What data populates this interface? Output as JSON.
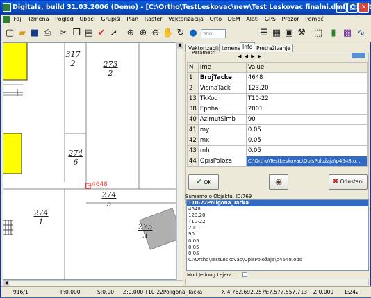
{
  "window": {
    "title": "Digitals, build 31.03.2006 (Demo) - [C:\\Ortho\\TestLeskovac\\new\\Test Leskovac finalni.dmf, C:\\Ortho\\TestLeskova...",
    "min_glyph": "_",
    "max_glyph": "□",
    "close_glyph": "✕"
  },
  "menu": [
    "Fajl",
    "Izmena",
    "Pogled",
    "Ubaci",
    "Grupiši",
    "Plan",
    "Raster",
    "Vektorizacija",
    "Orto",
    "DEM",
    "Alati",
    "GPS",
    "Prozor",
    "Pomoć"
  ],
  "toolbar": {
    "zoom_value": "500"
  },
  "map": {
    "parcels": [
      {
        "top": "317",
        "bottom": "2"
      },
      {
        "top": "273",
        "bottom": "2"
      },
      {
        "top": "274",
        "bottom": "6"
      },
      {
        "top": "274",
        "bottom": "5"
      },
      {
        "top": "275",
        "bottom": "3"
      },
      {
        "top": "274",
        "bottom": "1"
      }
    ],
    "point_label": "4648",
    "colors": {
      "building": "#ffff00",
      "gray_building": "#b0b0b0",
      "point": "#e53935"
    }
  },
  "panel": {
    "tabs": [
      "Vektorizacija",
      "Izmena",
      "Info",
      "Pretraživanje"
    ],
    "active_tab": "Info",
    "group_label": "Parametri",
    "columns": [
      "N",
      "Ime",
      "Value"
    ],
    "rows": [
      [
        "1",
        "BrojTacke",
        "4648"
      ],
      [
        "2",
        "VisinaTack",
        "123.20"
      ],
      [
        "13",
        "TkKod",
        "T10-22"
      ],
      [
        "38",
        "Epoha",
        "2001"
      ],
      [
        "40",
        "AzimutSimb",
        "90"
      ],
      [
        "41",
        "my",
        "0.05"
      ],
      [
        "42",
        "mx",
        "0.05"
      ],
      [
        "43",
        "mh",
        "0.05"
      ],
      [
        "44",
        "OpisPoloza",
        "C:\\Ortho\\TestLeskovac\\OpisPoložaja\\p4648.o..."
      ]
    ],
    "ok_label": "OK",
    "cancel_label": "Odustani",
    "summary_label": "Sumarno o Objektu, ID:769",
    "summary_header": "T10-22Poligona_Tacka",
    "summary_lines": [
      "4648",
      "123.20",
      "T10-22",
      "2001",
      "90",
      "0.05",
      "0.05",
      "0.05",
      "C:\\Ortho\\TestLeskovac\\OpisPoložaja\\p4648.ods"
    ],
    "single_layer_label": "Mod Jednog Lejera"
  },
  "status": {
    "scale": "916/1",
    "p": "P:0.000",
    "s": "S:0.00",
    "z_layer": "Z:0.000 T10-22Poligona_Tacka",
    "x": "X:4.762.692.257",
    "y": "Y:7.577.557.713",
    "z": "Z:0.000",
    "ratio": "1:242"
  }
}
